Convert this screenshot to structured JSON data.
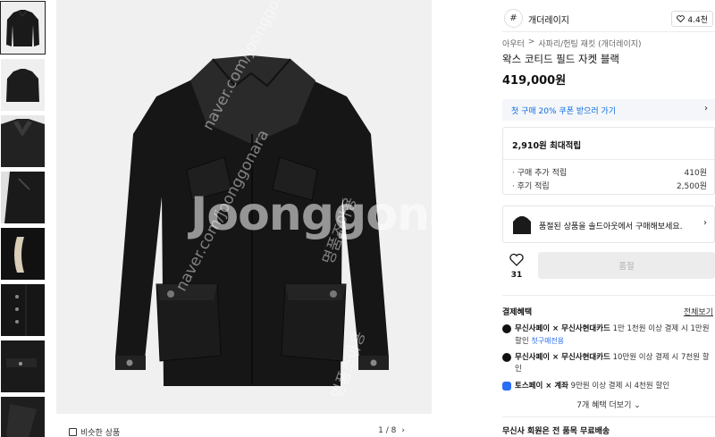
{
  "thumbnails": [
    {
      "label": "thumb-1"
    },
    {
      "label": "thumb-2"
    },
    {
      "label": "thumb-3"
    },
    {
      "label": "thumb-4"
    },
    {
      "label": "thumb-5"
    },
    {
      "label": "thumb-6"
    },
    {
      "label": "thumb-7"
    },
    {
      "label": "thumb-8"
    }
  ],
  "gallery": {
    "watermark_main": "Joonggonara",
    "watermark_url": "naver.com/joonggonara",
    "watermark_ko": "명품조아용",
    "similar_label": "비슷한 상품",
    "pager_text": "1 / 8",
    "pager_next": "›"
  },
  "brand": {
    "logo_glyph": "#",
    "name": "개더레이지",
    "like_icon": "heart-outline-icon",
    "like_count": "4.4천"
  },
  "breadcrumb": [
    "아우터",
    ">",
    "사파리/헌팅 재킷 (개더레이지)"
  ],
  "product": {
    "title": "왁스 코티드 필드 자켓 블랙",
    "price": "419,000원"
  },
  "coupon": {
    "text": "첫 구매 20% 쿠폰 받으러 가기",
    "arrow": "›"
  },
  "points": {
    "max": "2,910원 최대적립",
    "rows": [
      {
        "label": "· 구매 추가 적립",
        "value": "410원"
      },
      {
        "label": "· 후기 적립",
        "value": "2,500원"
      }
    ]
  },
  "soldout": {
    "text": "품절된 상품을 솔드아웃에서 구매해보세요.",
    "arrow": "›"
  },
  "actions": {
    "heart_count": "31",
    "buy_label": "품절"
  },
  "benefits": {
    "title": "결제혜택",
    "view_all": "전체보기",
    "items": [
      {
        "brand": "무신사페이 × 무신사현대카드",
        "text": " 1만 1천원 이상 결제 시 1만원 할인",
        "tag": "첫구매전용"
      },
      {
        "brand": "무신사페이 × 무신사현대카드",
        "text": " 10만원 이상 결제 시 7천원 할인",
        "tag": ""
      },
      {
        "brand": "토스페이 × 계좌",
        "text": " 9만원 이상 결제 시 4천원 할인",
        "tag": ""
      }
    ],
    "more": "7개 혜택 더보기 ⌄"
  },
  "delivery": {
    "text": "무신사 회원은 전 품목 무료배송"
  },
  "colors": {
    "accent_blue": "#0a6de0",
    "disabled_bg": "#ececec",
    "jacket": "#1a1a1a"
  }
}
